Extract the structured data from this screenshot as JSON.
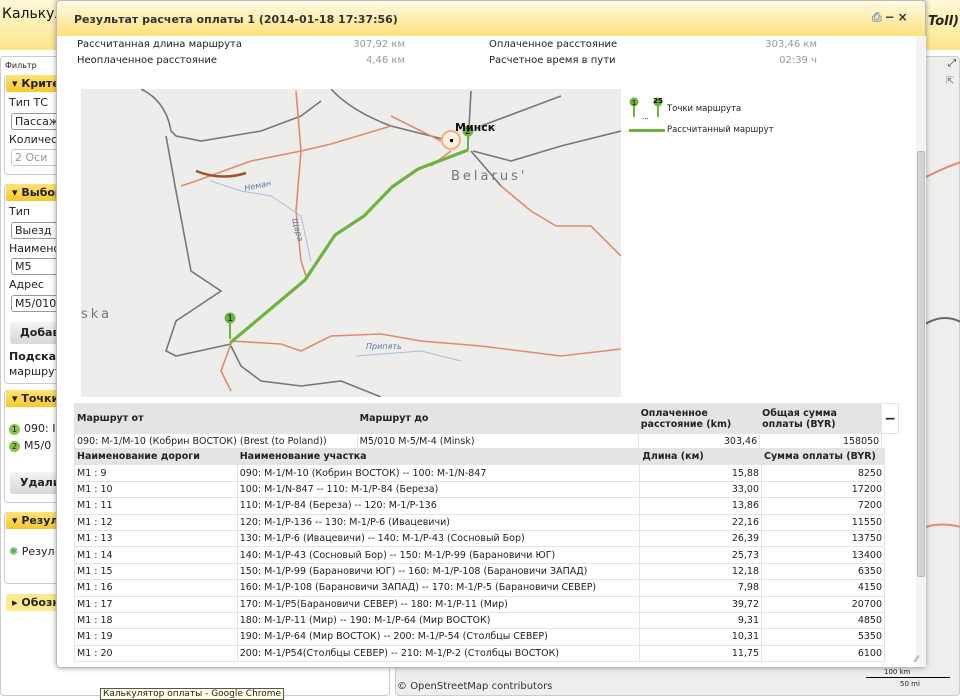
{
  "app": {
    "title": "Калькул",
    "logo": "Toll)",
    "filter_label": "Фильтр",
    "sections": {
      "criteria": "Критер",
      "select": "Выбор",
      "points": "Точки",
      "results": "Резуль",
      "legend": "Обозна"
    },
    "criteria": {
      "vehicle_type_label": "Тип ТС",
      "vehicle_type": "Пассажи",
      "count_label": "Количест",
      "count": "2 Оси"
    },
    "select": {
      "type_label": "Тип",
      "type": "Выезд и",
      "name_label": "Наименов",
      "name": "M5",
      "address_label": "Адрес",
      "address": "M5/010",
      "add_button": "Добав",
      "hint_title": "Подсказ",
      "hint_text": "маршрута"
    },
    "points": {
      "items": [
        {
          "n": "1",
          "text": "090: I"
        },
        {
          "n": "2",
          "text": "M5/0"
        }
      ],
      "delete_button": "Удалит"
    },
    "results": {
      "item": "Резул"
    },
    "osm": {
      "prefix": "©",
      "link": "OpenStreetMap",
      "suffix": "contributors"
    },
    "scale": {
      "km": "100 km",
      "mi": "50 mi"
    },
    "tooltip": "Калькулятор оплаты - Google Chrome"
  },
  "modal": {
    "title": "Результат расчета оплаты 1 (2014-01-18 17:37:56)",
    "tools": {
      "print": "print-icon",
      "minimize": "−",
      "close": "×"
    },
    "stats": [
      {
        "label": "Рассчитанная длина маршрута",
        "value": "307,92 км"
      },
      {
        "label": "Неоплаченное расстояние",
        "value": "4,46 км"
      },
      {
        "label": "Оплаченное расстояние",
        "value": "303,46 км"
      },
      {
        "label": "Расчетное время в пути",
        "value": "02:39 ч"
      }
    ],
    "map": {
      "labels": {
        "city": "Минск",
        "country": "Belarus'",
        "region": "ska",
        "river1": "Неман",
        "river2": "Щара",
        "river3": "Припять"
      },
      "pins": [
        "1",
        "2"
      ],
      "route_color": "#6db33f"
    },
    "legend": {
      "pin_first": "1",
      "pin_last": "25",
      "ellipsis": "...",
      "points_label": "Точки маршрута",
      "route_label": "Рассчитанный маршрут"
    },
    "summary": {
      "headers": [
        "Маршрут от",
        "Маршрут до",
        "Оплаченное расстояние (km)",
        "Общая сумма оплаты (BYR)"
      ],
      "collapse": "−",
      "row": [
        "090: M-1/M-10 (Кобрин ВОСТОК) (Brest (to Poland))",
        "M5/010 M-5/M-4 (Minsk)",
        "303,46",
        "158050"
      ]
    },
    "details": {
      "headers": [
        "Наименование дороги",
        "Наименование участка",
        "Длина (км)",
        "Сумма оплаты (BYR)"
      ],
      "rows": [
        [
          "M1 : 9",
          "090: M-1/M-10 (Кобрин ВОСТОК) -- 100: M-1/N-847",
          "15,88",
          "8250"
        ],
        [
          "M1 : 10",
          "100: M-1/N-847 -- 110: M-1/P-84 (Береза)",
          "33,00",
          "17200"
        ],
        [
          "M1 : 11",
          "110: M-1/P-84 (Береза) -- 120: M-1/P-136",
          "13,86",
          "7200"
        ],
        [
          "M1 : 12",
          "120: M-1/P-136 -- 130: M-1/P-6 (Ивацевичи)",
          "22,16",
          "11550"
        ],
        [
          "M1 : 13",
          "130: M-1/P-6 (Ивацевичи) -- 140: M-1/P-43 (Сосновый Бор)",
          "26,39",
          "13750"
        ],
        [
          "M1 : 14",
          "140: M-1/P-43 (Сосновый Бор) -- 150: M-1/P-99 (Барановичи ЮГ)",
          "25,73",
          "13400"
        ],
        [
          "M1 : 15",
          "150: M-1/P-99 (Барановичи ЮГ) -- 160: M-1/P-108 (Барановичи ЗАПАД)",
          "12,18",
          "6350"
        ],
        [
          "M1 : 16",
          "160: M-1/P-108 (Барановичи ЗАПАД) -- 170: M-1/P-5 (Барановичи СЕВЕР)",
          "7,98",
          "4150"
        ],
        [
          "M1 : 17",
          "170: M-1/P5(Барановичи СЕВЕР) -- 180: M-1/P-11 (Мир)",
          "39,72",
          "20700"
        ],
        [
          "M1 : 18",
          "180: M-1/P-11 (Мир) -- 190: M-1/P-64 (Мир ВОСТОК)",
          "9,31",
          "4850"
        ],
        [
          "M1 : 19",
          "190: M-1/P-64 (Мир ВОСТОК) -- 200: M-1/P-54 (Столбцы СЕВЕР)",
          "10,31",
          "5350"
        ],
        [
          "M1 : 20",
          "200: M-1/P54(Столбцы СЕВЕР) -- 210: M-1/P-2 (Столбцы ВОСТОК)",
          "11,75",
          "6100"
        ]
      ]
    }
  }
}
